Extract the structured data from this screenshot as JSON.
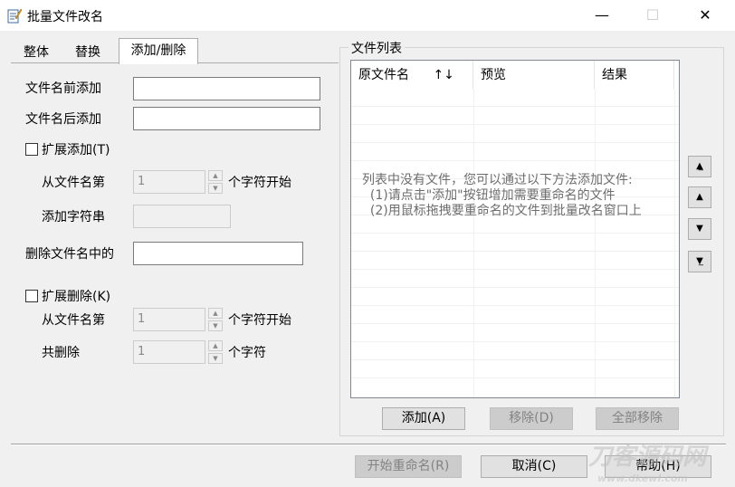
{
  "window": {
    "title": "批量文件改名",
    "minimize_glyph": "—",
    "maximize_glyph": "☐",
    "close_glyph": "✕",
    "icon": "rename-app-icon"
  },
  "tabs": [
    {
      "label": "整体",
      "active": false
    },
    {
      "label": "替换",
      "active": false
    },
    {
      "label": "添加/删除",
      "active": true
    }
  ],
  "add_panel": {
    "prefix_label": "文件名前添加",
    "prefix_value": "",
    "suffix_label": "文件名后添加",
    "suffix_value": "",
    "ext_add_checkbox_label": "扩展添加(T)",
    "ext_add_checked": false,
    "from_pos_label": "从文件名第",
    "from_pos_value": "1",
    "from_pos_suffix": "个字符开始",
    "add_string_label": "添加字符串",
    "add_string_value": ""
  },
  "delete_panel": {
    "delete_label": "删除文件名中的",
    "delete_value": "",
    "ext_delete_checkbox_label": "扩展删除(K)",
    "ext_delete_checked": false,
    "from_pos_label": "从文件名第",
    "from_pos_value": "1",
    "from_pos_suffix": "个字符开始",
    "count_label": "共删除",
    "count_value": "1",
    "count_suffix": "个字符"
  },
  "file_list": {
    "group_label": "文件列表",
    "columns": {
      "original_name": "原文件名",
      "sort_glyph": "↑↓",
      "preview": "预览",
      "result": "结果"
    },
    "empty_hint": "列表中没有文件，您可以通过以下方法添加文件:\n  (1)请点击\"添加\"按钮增加需要重命名的文件\n  (2)用鼠标拖拽要重命名的文件到批量改名窗口上",
    "add_button": "添加(A)",
    "remove_button": "移除(D)",
    "remove_all_button": "全部移除",
    "side_buttons": [
      "move-top",
      "move-up",
      "move-down",
      "move-bottom"
    ]
  },
  "footer": {
    "start_button": "开始重命名(R)",
    "cancel_button": "取消(C)",
    "help_button": "帮助(H)"
  },
  "watermark": {
    "line1": "刀客源码网",
    "line2": "www.dkewl.com"
  }
}
